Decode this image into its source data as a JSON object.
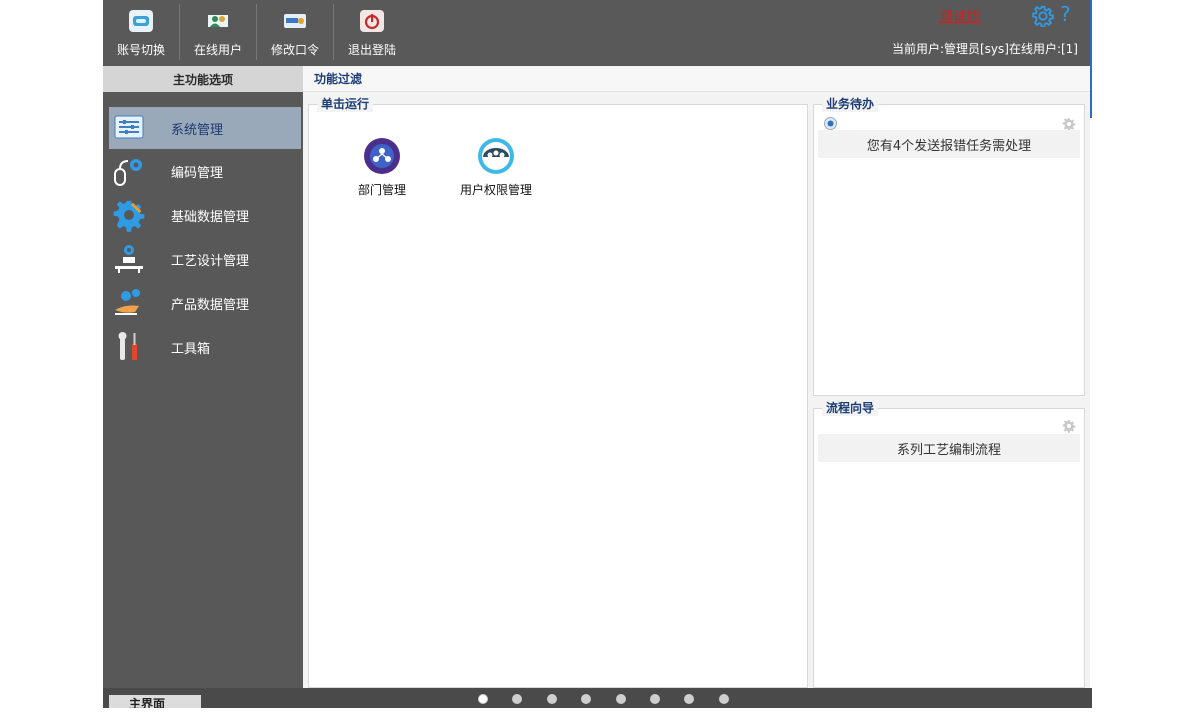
{
  "toolbar": {
    "buttons": [
      {
        "label": "账号切换",
        "icon": "account-switch-icon"
      },
      {
        "label": "在线用户",
        "icon": "online-users-icon"
      },
      {
        "label": "修改口令",
        "icon": "change-password-icon"
      },
      {
        "label": "退出登陆",
        "icon": "logout-icon"
      }
    ],
    "warning_text": "测试版",
    "current_user": "当前用户:管理员[sys]在线用户:[1]"
  },
  "sidebar": {
    "header": "主功能选项",
    "items": [
      {
        "label": "系统管理",
        "icon": "system-settings-icon",
        "active": true
      },
      {
        "label": "编码管理",
        "icon": "coding-icon"
      },
      {
        "label": "基础数据管理",
        "icon": "gear-icon"
      },
      {
        "label": "工艺设计管理",
        "icon": "process-design-icon"
      },
      {
        "label": "产品数据管理",
        "icon": "product-data-icon"
      },
      {
        "label": "工具箱",
        "icon": "toolbox-icon"
      }
    ]
  },
  "main": {
    "filter_label": "功能过滤",
    "run_group": {
      "title": "单击运行",
      "functions": [
        {
          "label": "部门管理",
          "icon": "department-icon"
        },
        {
          "label": "用户权限管理",
          "icon": "user-permission-icon"
        }
      ]
    },
    "todo_group": {
      "title": "业务待办",
      "message": "您有4个发送报错任务需处理"
    },
    "flow_group": {
      "title": "流程向导",
      "item": "系列工艺编制流程"
    }
  },
  "bottom": {
    "home_tab": "主界面",
    "page_count": 8,
    "active_page": 1
  },
  "colors": {
    "toolbar_bg": "#595959",
    "sidebar_bg": "#585858",
    "active_item_bg": "#9aa9ba",
    "title_text": "#1d3d74",
    "warning": "#d61e1e",
    "accent_blue": "#2f9be5"
  }
}
